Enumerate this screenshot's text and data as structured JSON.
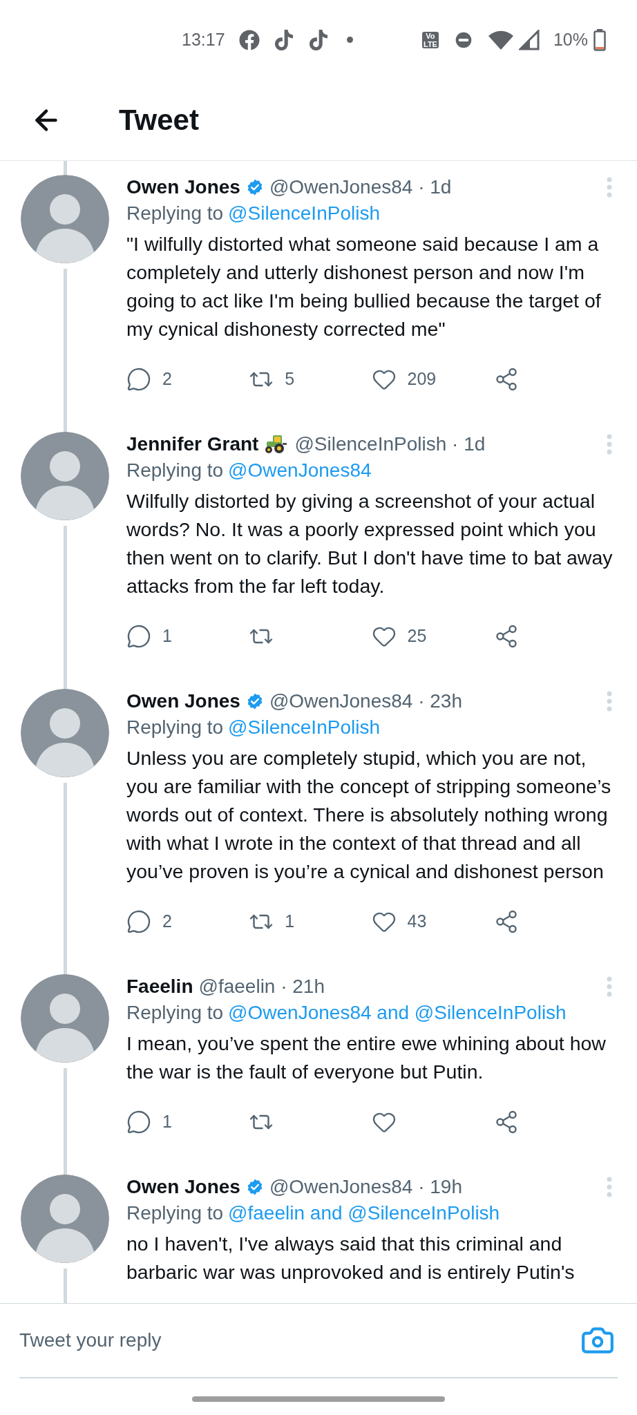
{
  "status_bar": {
    "time": "13:17",
    "network_badge": [
      "Vo",
      "LTE"
    ],
    "battery": "10%"
  },
  "header": {
    "title": "Tweet"
  },
  "tweets": [
    {
      "name": "Owen Jones",
      "verified": true,
      "tractor": false,
      "meta": "@OwenJones84 · 1d",
      "replying_label": "Replying to",
      "replying_to": "@SilenceInPolish",
      "body": "\"I wilfully distorted what someone said because I am a completely and utterly dishonest person and now I'm going to act like I'm being bullied because the target of my cynical dishonesty corrected me\"",
      "replies": "2",
      "retweets": "5",
      "likes": "209"
    },
    {
      "name": "Jennifer Grant",
      "verified": false,
      "tractor": true,
      "meta": "@SilenceInPolish · 1d",
      "replying_label": "Replying to",
      "replying_to": "@OwenJones84",
      "body": "Wilfully distorted by giving a screenshot of your actual words? No. It was a poorly expressed point which you then went on to clarify. But I don't have time to bat away attacks from the far left today.",
      "replies": "1",
      "likes": "25"
    },
    {
      "name": "Owen Jones",
      "verified": true,
      "tractor": false,
      "meta": "@OwenJones84 · 23h",
      "replying_label": "Replying to",
      "replying_to": "@SilenceInPolish",
      "body": "Unless you are completely stupid, which you are not, you are familiar with the concept of stripping someone’s words out of context. There is absolutely nothing wrong with what I wrote in the context of that thread and all you’ve proven is you’re a cynical and dishonest person",
      "replies": "2",
      "retweets": "1",
      "likes": "43"
    },
    {
      "name": "Faeelin",
      "verified": false,
      "tractor": false,
      "meta": "@faeelin · 21h",
      "replying_label": "Replying to",
      "replying_to": "@OwenJones84 and @SilenceInPolish",
      "body": "I mean, you’ve spent the entire ewe whining about how the war is the fault of everyone but Putin.",
      "replies": "1"
    },
    {
      "name": "Owen Jones",
      "verified": true,
      "tractor": false,
      "meta": "@OwenJones84 · 19h",
      "replying_label": "Replying to",
      "replying_to": "@faeelin and @SilenceInPolish",
      "body": "no I haven't, I've always said that this criminal and barbaric war was unprovoked and is entirely Putin's"
    }
  ],
  "reply_bar": {
    "placeholder": "Tweet your reply"
  }
}
